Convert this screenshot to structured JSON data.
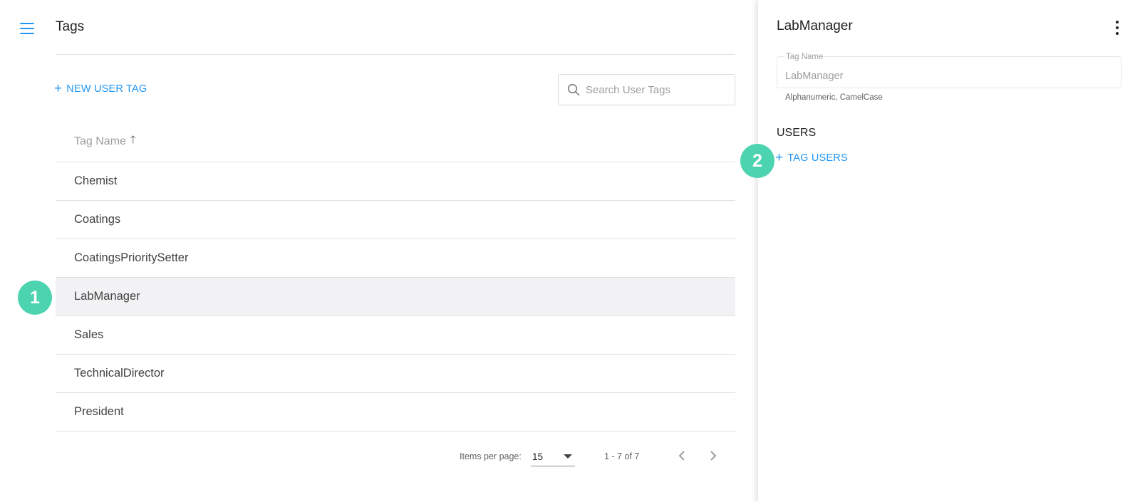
{
  "header": {
    "title": "Tags",
    "menu_icon": "hamburger-menu-icon"
  },
  "toolbar": {
    "new_tag_label": "NEW USER TAG"
  },
  "search": {
    "placeholder": "Search User Tags"
  },
  "table": {
    "column_header": "Tag Name",
    "sort_direction": "ascending",
    "rows": [
      "Chemist",
      "Coatings",
      "CoatingsPrioritySetter",
      "LabManager",
      "Sales",
      "TechnicalDirector",
      "President"
    ],
    "selected_row": "LabManager"
  },
  "paginator": {
    "items_per_page_label": "Items per page:",
    "items_per_page_value": "15",
    "range_label": "1 - 7 of 7"
  },
  "detail": {
    "title": "LabManager",
    "field_label": "Tag Name",
    "field_value": "LabManager",
    "field_hint": "Alphanumeric, CamelCase",
    "users_heading": "USERS",
    "tag_users_label": "TAG USERS"
  },
  "markers": [
    "1",
    "2"
  ],
  "colors": {
    "accent": "#2196f3",
    "marker": "#4cd3b0",
    "selected_row": "#f2f2f4"
  }
}
